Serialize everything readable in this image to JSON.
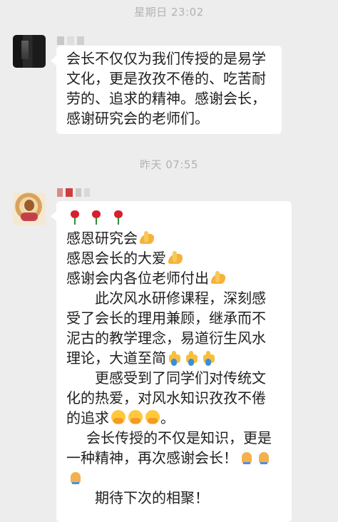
{
  "chat": {
    "timestamp_1": "星期日 23:02",
    "timestamp_2": "昨天 07:55",
    "message_1_lines": [
      "会长不仅仅为我们传授的是易学",
      "文化，更是孜孜不倦的、吃苦耐",
      "劳的、追求的精神。感谢会长，",
      "感谢研究会的老师们。"
    ],
    "message_2": {
      "line_1": "感恩研究会",
      "line_2": "感恩会长的大爱",
      "line_3": "感谢会内各位老师付出",
      "line_4": "此次风水研修课程，深刻感",
      "line_5": "受了会长的理用兼顾，继承而不",
      "line_6": "泥古的教学理念，易道衍生风水",
      "line_7": "理论，大道至简",
      "line_8": "更感受到了同学们对传统文",
      "line_9": "化的热爱，对风水知识孜孜不倦",
      "line_10": "的追求",
      "line_10_suffix": "。",
      "line_11": "会长传授的不仅是知识，更是",
      "line_12": "一种精神，再次感谢会长！",
      "line_14": "期待下次的相聚！"
    }
  },
  "icons": {
    "rose": "rose-icon",
    "pray": "folded-hands-icon",
    "thumbs_up": "thumbs-up-icon",
    "hug": "hugging-face-icon"
  },
  "colors": {
    "background": "#ededed",
    "bubble": "#ffffff",
    "timestamp": "#b2b2b2",
    "text": "#1f1f1f"
  }
}
